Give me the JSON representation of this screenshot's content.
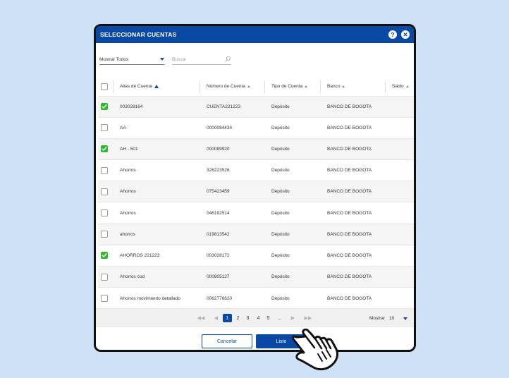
{
  "dialog": {
    "title": "SELECCIONAR CUENTAS",
    "help_label": "?",
    "close_label": "✕"
  },
  "filters": {
    "show_select": "Mostrar Todos",
    "search_placeholder": "Buscar"
  },
  "table": {
    "columns": [
      "Alias de Cuenta",
      "Número de Cuenta",
      "Tipo de Cuenta",
      "Banco",
      "Saldo"
    ],
    "rows": [
      {
        "checked": true,
        "alias": "003028164",
        "numero": "CUENTA221223",
        "tipo": "Depósito",
        "banco": "BANCO DE BOGOTA"
      },
      {
        "checked": false,
        "alias": "AA",
        "numero": "0000084434",
        "tipo": "Depósito",
        "banco": "BANCO DE BOGOTA"
      },
      {
        "checked": true,
        "alias": "AH - 501",
        "numero": "000089920",
        "tipo": "Depósito",
        "banco": "BANCO DE BOGOTA"
      },
      {
        "checked": false,
        "alias": "Ahorros",
        "numero": "326223526",
        "tipo": "Depósito",
        "banco": "BANCO DE BOGOTA"
      },
      {
        "checked": false,
        "alias": "Ahorros",
        "numero": "075423459",
        "tipo": "Depósito",
        "banco": "BANCO DE BOGOTA"
      },
      {
        "checked": false,
        "alias": "Ahorros",
        "numero": "046192514",
        "tipo": "Depósito",
        "banco": "BANCO DE BOGOTA"
      },
      {
        "checked": false,
        "alias": "ahorros",
        "numero": "019813542",
        "tipo": "Depósito",
        "banco": "BANCO DE BOGOTA"
      },
      {
        "checked": true,
        "alias": "AHORROS 221223",
        "numero": "003028172",
        "tipo": "Depósito",
        "banco": "BANCO DE BOGOTA"
      },
      {
        "checked": false,
        "alias": "Ahorros cod",
        "numero": "000805127",
        "tipo": "Depósito",
        "banco": "BANCO DE BOGOTA"
      },
      {
        "checked": false,
        "alias": "Ahorros movimiento detallado",
        "numero": "0062776620",
        "tipo": "Depósito",
        "banco": "BANCO DE BOGOTA"
      }
    ]
  },
  "pagination": {
    "first": "◀◀",
    "prev": "◀",
    "pages": [
      "1",
      "2",
      "3",
      "4",
      "5",
      "..."
    ],
    "next": "▶",
    "last": "▶▶",
    "show_label": "Mostrar",
    "page_size": "10"
  },
  "footer": {
    "cancel_label": "Cancelar",
    "ok_label": "Listo"
  },
  "colors": {
    "primary": "#0a48a6",
    "check": "#2eb82e",
    "background": "#cfe1f6"
  },
  "icons": [
    "help-icon",
    "close-icon",
    "chevron-down-icon",
    "search-icon",
    "sort-up-icon",
    "hand-pointer-icon"
  ]
}
